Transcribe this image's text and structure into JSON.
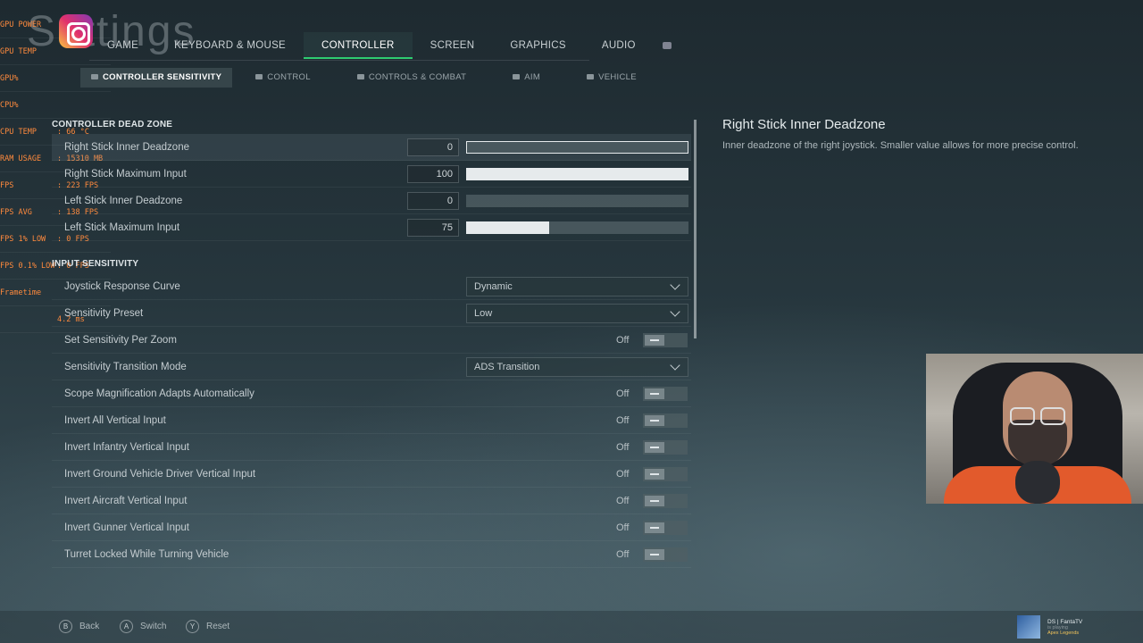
{
  "page": {
    "title_bg": "Settings"
  },
  "hud": [
    {
      "k": "GPU POWER",
      "v": ""
    },
    {
      "k": "GPU TEMP",
      "v": ""
    },
    {
      "k": "GPU%",
      "v": ""
    },
    {
      "k": "CPU%",
      "v": ""
    },
    {
      "k": "CPU TEMP",
      "v": ": 66 °C"
    },
    {
      "k": "RAM USAGE",
      "v": ": 15310 MB"
    },
    {
      "k": "FPS",
      "v": ": 223 FPS"
    },
    {
      "k": "FPS AVG",
      "v": ": 138 FPS"
    },
    {
      "k": "FPS 1% LOW",
      "v": ": 0 FPS"
    },
    {
      "k": "FPS 0.1% LOW",
      "v": ": 0 FPS"
    },
    {
      "k": "Frametime",
      "v": ""
    },
    {
      "k": "",
      "v": "4.2 ms"
    }
  ],
  "tabs": [
    "GAME",
    "KEYBOARD & MOUSE",
    "CONTROLLER",
    "SCREEN",
    "GRAPHICS",
    "AUDIO"
  ],
  "subtabs": [
    "CONTROLLER SENSITIVITY",
    "CONTROL",
    "CONTROLS & COMBAT",
    "AIM",
    "VEHICLE"
  ],
  "sections": {
    "deadzone": "CONTROLLER DEAD ZONE",
    "input": "INPUT SENSITIVITY"
  },
  "deadzone_rows": [
    {
      "label": "Right Stick Inner Deadzone",
      "value": "0",
      "fill": 0
    },
    {
      "label": "Right Stick Maximum Input",
      "value": "100",
      "fill": 100
    },
    {
      "label": "Left Stick Inner Deadzone",
      "value": "0",
      "fill": 0
    },
    {
      "label": "Left Stick Maximum Input",
      "value": "75",
      "fill": 37.5
    }
  ],
  "input_rows": [
    {
      "label": "Joystick Response Curve",
      "type": "dropdown",
      "value": "Dynamic"
    },
    {
      "label": "Sensitivity Preset",
      "type": "dropdown",
      "value": "Low"
    },
    {
      "label": "Set Sensitivity Per Zoom",
      "type": "toggle",
      "value": "Off"
    },
    {
      "label": "Sensitivity Transition Mode",
      "type": "dropdown",
      "value": "ADS Transition"
    },
    {
      "label": "Scope Magnification Adapts Automatically",
      "type": "toggle",
      "value": "Off"
    },
    {
      "label": "Invert All Vertical Input",
      "type": "toggle",
      "value": "Off"
    },
    {
      "label": "Invert Infantry Vertical Input",
      "type": "toggle",
      "value": "Off"
    },
    {
      "label": "Invert Ground Vehicle Driver Vertical Input",
      "type": "toggle",
      "value": "Off"
    },
    {
      "label": "Invert Aircraft Vertical Input",
      "type": "toggle",
      "value": "Off"
    },
    {
      "label": "Invert Gunner Vertical Input",
      "type": "toggle",
      "value": "Off"
    },
    {
      "label": "Turret Locked While Turning Vehicle",
      "type": "toggle",
      "value": "Off"
    }
  ],
  "description": {
    "title": "Right Stick Inner Deadzone",
    "text": "Inner deadzone of the right joystick. Smaller value allows for more precise control."
  },
  "hints": [
    {
      "key": "B",
      "label": "Back"
    },
    {
      "key": "A",
      "label": "Switch"
    },
    {
      "key": "Y",
      "label": "Reset"
    }
  ],
  "notification": {
    "name": "DS | FantaTV",
    "status": "is playing",
    "game": "Apex Legends"
  },
  "colors": {
    "accent": "#2ecc71",
    "hud": "#ff8a3d"
  }
}
